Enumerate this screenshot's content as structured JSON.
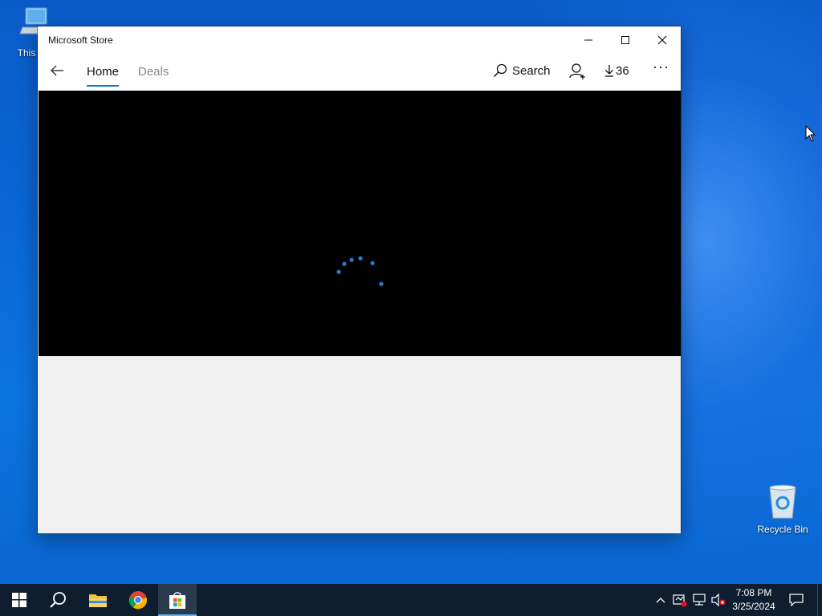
{
  "desktop": {
    "this_pc_label": "This PC",
    "recycle_bin_label": "Recycle Bin"
  },
  "window": {
    "title": "Microsoft Store",
    "nav": {
      "tabs": [
        {
          "label": "Home",
          "active": true
        },
        {
          "label": "Deals",
          "active": false
        }
      ],
      "search_label": "Search",
      "downloads_count": "36",
      "more_label": "···"
    },
    "hero": {
      "state": "loading"
    }
  },
  "taskbar": {
    "apps": [
      "start-icon",
      "search-icon",
      "file-explorer-icon",
      "chrome-icon",
      "microsoft-store-icon"
    ],
    "clock": {
      "time": "7:08 PM",
      "date": "3/25/2024"
    }
  },
  "colors": {
    "accent": "#0f7bd6",
    "taskbar": "#0e1e2e",
    "desktop": "#0a66d6"
  }
}
